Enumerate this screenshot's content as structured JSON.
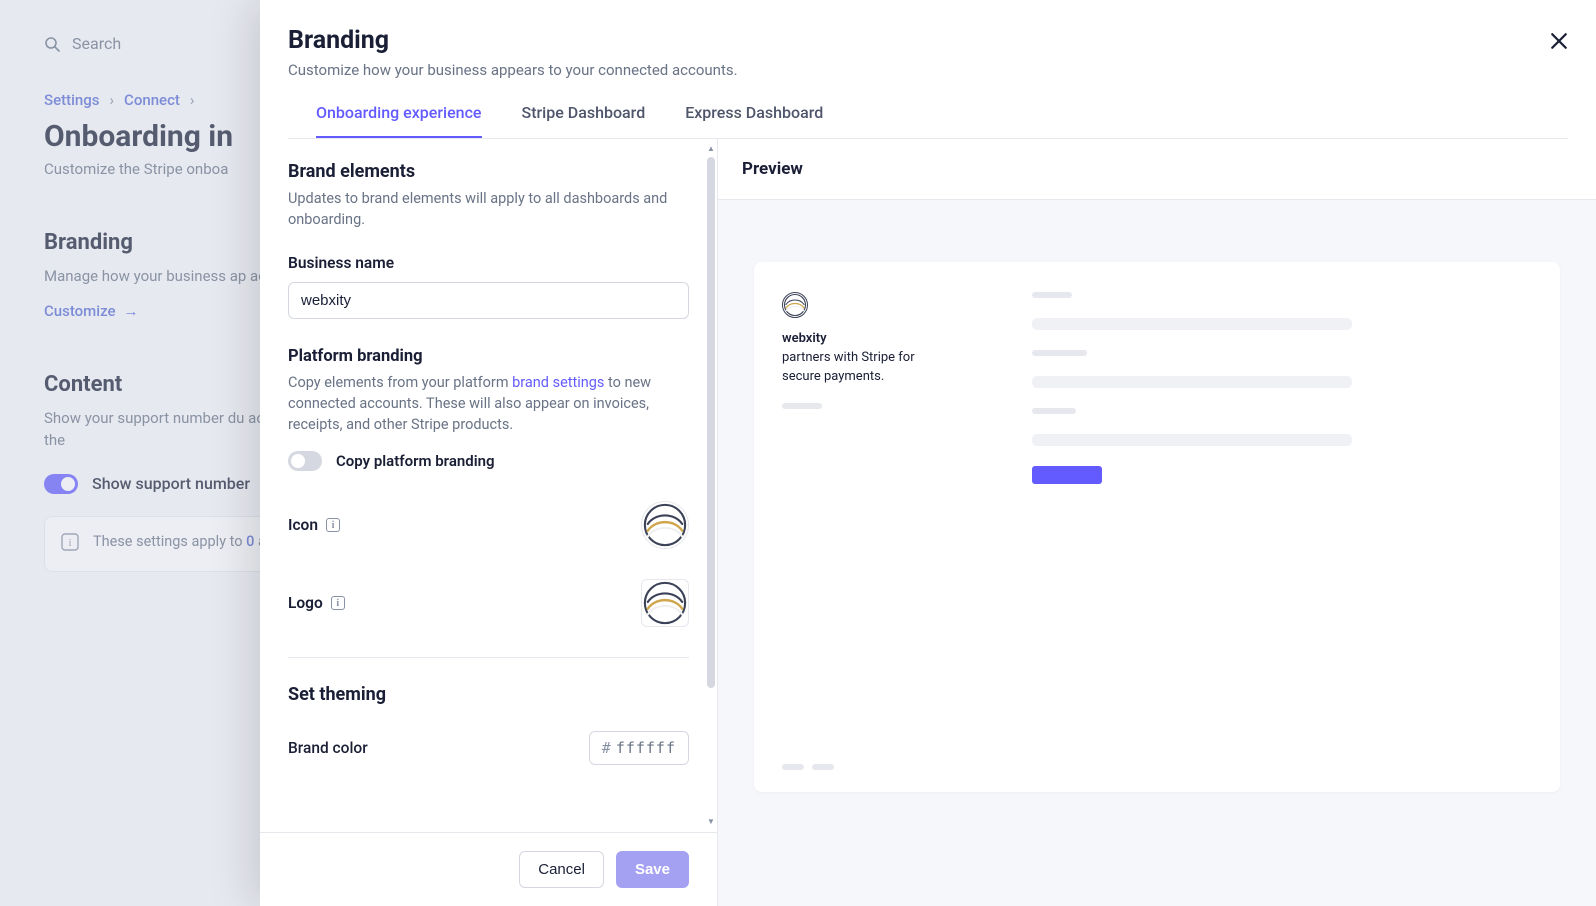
{
  "background": {
    "search_placeholder": "Search",
    "breadcrumb": {
      "item1": "Settings",
      "item2": "Connect"
    },
    "page_title": "Onboarding in",
    "page_subtitle": "Customize the Stripe onboa",
    "branding": {
      "title": "Branding",
      "desc": "Manage how your business ap accounts.",
      "customize_link": "Customize"
    },
    "content": {
      "title": "Content",
      "desc": "Show your support number du accounts for which you are the",
      "toggle_label": "Show support number",
      "info_prefix": "These settings apply to ",
      "info_count": "0",
      "info_suffix": " accounts."
    }
  },
  "modal": {
    "title": "Branding",
    "subtitle": "Customize how your business appears to your connected accounts.",
    "tabs": [
      "Onboarding experience",
      "Stripe Dashboard",
      "Express Dashboard"
    ],
    "section_brand": {
      "title": "Brand elements",
      "desc": "Updates to brand elements will apply to all dashboards and onboarding."
    },
    "business_name": {
      "label": "Business name",
      "value": "webxity"
    },
    "platform": {
      "title": "Platform branding",
      "desc_pre": "Copy elements from your platform ",
      "link": "brand settings",
      "desc_post": " to new connected accounts. These will also appear on invoices, receipts, and other Stripe products.",
      "toggle_label": "Copy platform branding"
    },
    "icon_label": "Icon",
    "logo_label": "Logo",
    "theming": {
      "title": "Set theming",
      "color_label": "Brand color",
      "color_value": "ffffff"
    },
    "footer": {
      "cancel": "Cancel",
      "save": "Save"
    },
    "preview": {
      "title": "Preview",
      "brand_name": "webxity",
      "tagline": "partners with Stripe for secure payments."
    }
  }
}
